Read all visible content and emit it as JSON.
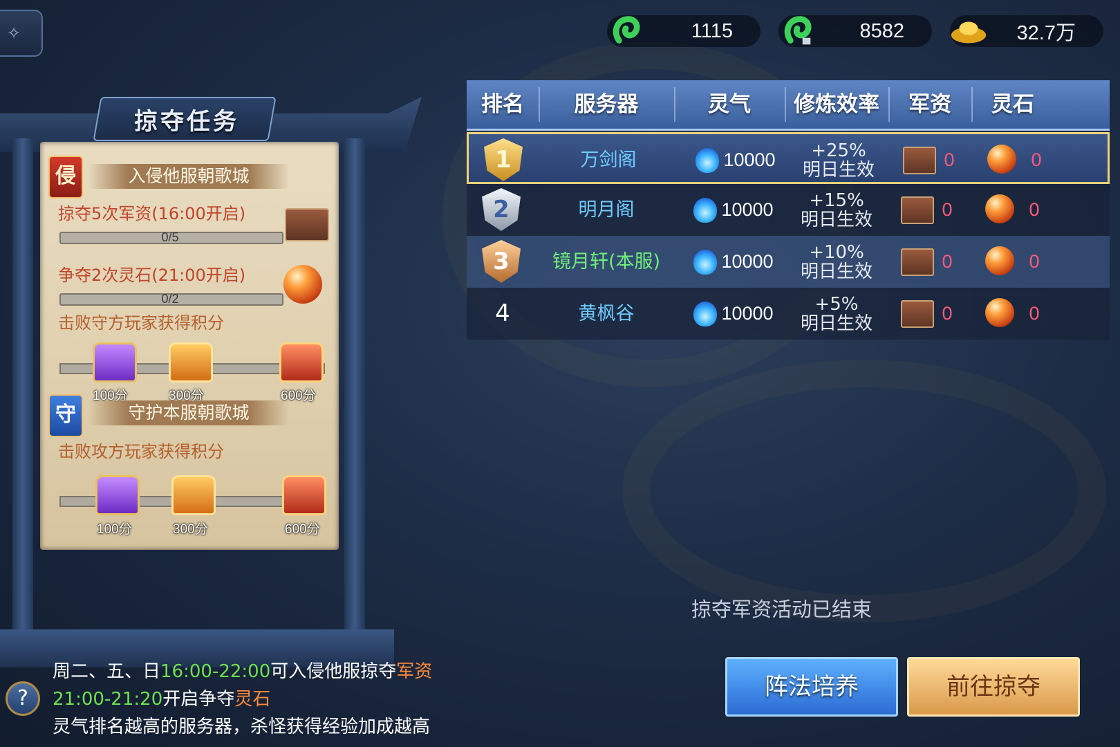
{
  "resources": [
    {
      "icon": "jade-icon",
      "value": "1115"
    },
    {
      "icon": "bound-jade-icon",
      "value": "8582"
    },
    {
      "icon": "gold-ingot-icon",
      "value": "32.7万"
    }
  ],
  "task_panel": {
    "title": "掠夺任务",
    "invade": {
      "badge": "侵",
      "title": "入侵他服朝歌城",
      "task1": {
        "label": "掠夺5次军资(16:00开启)",
        "progress_text": "0/5",
        "current": 0,
        "total": 5
      },
      "task2": {
        "label": "争夺2次灵石(21:00开启)",
        "progress_text": "0/2",
        "current": 0,
        "total": 2
      },
      "score_label": "击败守方玩家获得积分",
      "rewards": [
        "100分",
        "300分",
        "600分"
      ]
    },
    "defend": {
      "badge": "守",
      "title": "守护本服朝歌城",
      "score_label": "击败攻方玩家获得积分",
      "rewards": [
        "100分",
        "300分",
        "600分"
      ]
    }
  },
  "table": {
    "headers": [
      "排名",
      "服务器",
      "灵气",
      "修炼效率",
      "军资",
      "灵石"
    ],
    "rows": [
      {
        "rank": "1",
        "server": "万剑阁",
        "aura": "10000",
        "rate": "+25%",
        "rate_note": "明日生效",
        "supplies": "0",
        "stones": "0"
      },
      {
        "rank": "2",
        "server": "明月阁",
        "aura": "10000",
        "rate": "+15%",
        "rate_note": "明日生效",
        "supplies": "0",
        "stones": "0"
      },
      {
        "rank": "3",
        "server": "镜月轩(本服)",
        "aura": "10000",
        "rate": "+10%",
        "rate_note": "明日生效",
        "supplies": "0",
        "stones": "0"
      },
      {
        "rank": "4",
        "server": "黄枫谷",
        "aura": "10000",
        "rate": "+5%",
        "rate_note": "明日生效",
        "supplies": "0",
        "stones": "0"
      }
    ]
  },
  "status": "掠夺军资活动已结束",
  "buttons": {
    "formation": "阵法培养",
    "go_raid": "前往掠夺"
  },
  "info": {
    "line1": {
      "a": "周二、五、日",
      "b": "16:00-22:00",
      "c": "可入侵他服掠夺",
      "d": "军资"
    },
    "line2": {
      "a": "21:00-21:20",
      "b": "开启争夺",
      "c": "灵石"
    },
    "line3": "灵气排名越高的服务器，杀怪获得经验加成越高"
  },
  "colors": {
    "own_server": "#6ef07a",
    "server": "#6ecbff",
    "zero_value": "#ff5a7c",
    "highlight_green": "#6ee04e",
    "highlight_orange": "#ff8a3a"
  }
}
